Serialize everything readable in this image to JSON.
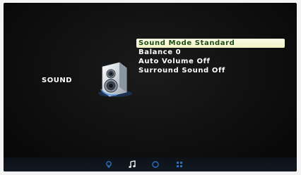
{
  "screen": {
    "section_title": "SOUND"
  },
  "menu": {
    "items": [
      {
        "label": "Sound Mode Standard",
        "selected": true
      },
      {
        "label": "Balance 0",
        "selected": false
      },
      {
        "label": "Auto Volume Off",
        "selected": false
      },
      {
        "label": "Surround Sound Off",
        "selected": false
      }
    ]
  },
  "bottom_tabs": [
    {
      "icon": "picture-icon",
      "active": false
    },
    {
      "icon": "music-note-icon",
      "active": true
    },
    {
      "icon": "clock-icon",
      "active": false
    },
    {
      "icon": "grid-settings-icon",
      "active": false
    }
  ],
  "colors": {
    "selected_bg": "#f1f1c6",
    "selected_text": "#1e4a12",
    "menu_text": "#ffffff",
    "tab_active": "#ffffff",
    "tab_inactive": "#2f6fbf",
    "background": "#0c0c0c"
  }
}
